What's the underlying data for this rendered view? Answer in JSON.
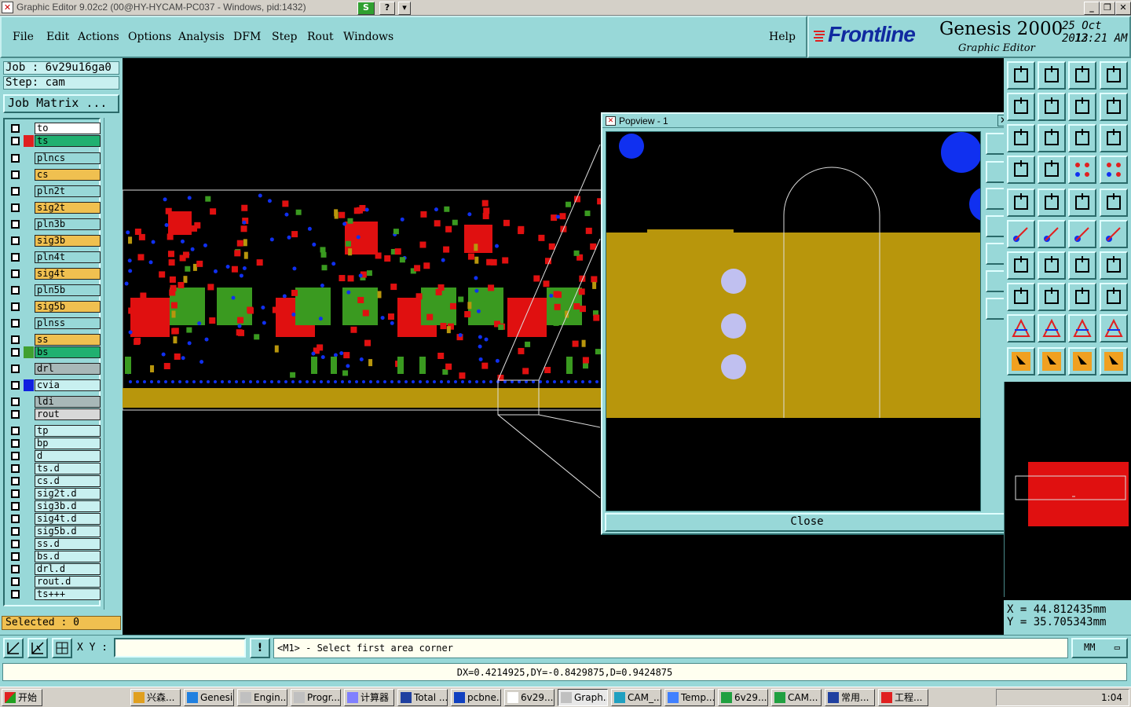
{
  "window": {
    "title": "Graphic Editor 9.02c2 (00@HY-HYCAM-PC037 - Windows, pid:1432)"
  },
  "menu": [
    "File",
    "Edit",
    "Actions",
    "Options",
    "Analysis",
    "DFM",
    "Step",
    "Rout",
    "Windows"
  ],
  "help_label": "Help",
  "brand": {
    "logo": "Frontline",
    "product": "Genesis 2000",
    "subtitle": "Graphic Editor",
    "date": "25 Oct 2013",
    "time": "12:21 AM"
  },
  "job": {
    "job_label": "Job : 6v29u16ga0",
    "step_label": "Step: cam",
    "matrix_label": "Job Matrix ..."
  },
  "layers": [
    {
      "name": "to",
      "color": "#ffffff",
      "swatch": ""
    },
    {
      "name": "ts",
      "color": "#20b070",
      "swatch": "#e02020"
    },
    {
      "name": "plncs",
      "color": "#98d8d8",
      "swatch": ""
    },
    {
      "name": "cs",
      "color": "#f0c050",
      "swatch": ""
    },
    {
      "name": "pln2t",
      "color": "#98d8d8",
      "swatch": ""
    },
    {
      "name": "sig2t",
      "color": "#f0c050",
      "swatch": ""
    },
    {
      "name": "pln3b",
      "color": "#98d8d8",
      "swatch": ""
    },
    {
      "name": "sig3b",
      "color": "#f0c050",
      "swatch": ""
    },
    {
      "name": "pln4t",
      "color": "#98d8d8",
      "swatch": ""
    },
    {
      "name": "sig4t",
      "color": "#f0c050",
      "swatch": ""
    },
    {
      "name": "pln5b",
      "color": "#98d8d8",
      "swatch": ""
    },
    {
      "name": "sig5b",
      "color": "#f0c050",
      "swatch": ""
    },
    {
      "name": "plnss",
      "color": "#98d8d8",
      "swatch": ""
    },
    {
      "name": "ss",
      "color": "#f0c050",
      "swatch": ""
    },
    {
      "name": "bs",
      "color": "#20b070",
      "swatch": "#40a030"
    },
    {
      "name": "drl",
      "color": "#a8b8b8",
      "swatch": ""
    },
    {
      "name": "cvia",
      "color": "#c8f0f0",
      "swatch": "#1020e0"
    },
    {
      "name": "ldi",
      "color": "#a8b8b8",
      "swatch": ""
    },
    {
      "name": "rout",
      "color": "#d8d8d8",
      "swatch": ""
    },
    {
      "name": "tp",
      "color": "#c8f0f0",
      "swatch": ""
    },
    {
      "name": "bp",
      "color": "#c8f0f0",
      "swatch": ""
    },
    {
      "name": "d",
      "color": "#c8f0f0",
      "swatch": ""
    },
    {
      "name": "ts.d",
      "color": "#c8f0f0",
      "swatch": ""
    },
    {
      "name": "cs.d",
      "color": "#c8f0f0",
      "swatch": ""
    },
    {
      "name": "sig2t.d",
      "color": "#c8f0f0",
      "swatch": ""
    },
    {
      "name": "sig3b.d",
      "color": "#c8f0f0",
      "swatch": ""
    },
    {
      "name": "sig4t.d",
      "color": "#c8f0f0",
      "swatch": ""
    },
    {
      "name": "sig5b.d",
      "color": "#c8f0f0",
      "swatch": ""
    },
    {
      "name": "ss.d",
      "color": "#c8f0f0",
      "swatch": ""
    },
    {
      "name": "bs.d",
      "color": "#c8f0f0",
      "swatch": ""
    },
    {
      "name": "drl.d",
      "color": "#c8f0f0",
      "swatch": ""
    },
    {
      "name": "rout.d",
      "color": "#c8f0f0",
      "swatch": ""
    },
    {
      "name": "ts+++",
      "color": "#c8f0f0",
      "swatch": ""
    }
  ],
  "selected_label": "Selected : 0",
  "popview": {
    "title": "Popview - 1",
    "close_label": "Close"
  },
  "coords": {
    "x": "X = 44.812435mm",
    "y": "Y = 35.705343mm"
  },
  "command": {
    "xy_label": "X Y :",
    "xy_value": "",
    "prompt": "<M1> - Select first area corner",
    "units": "MM"
  },
  "status": "DX=0.4214925,DY=-0.8429875,D=0.9424875",
  "taskbar": {
    "start": "开始",
    "tasks": [
      "兴森...",
      "Genesis",
      "Engin...",
      "Progr...",
      "计算器",
      "Total ...",
      "pcbne...",
      "6v29...",
      "Graph...",
      "CAM_...",
      "Temp...",
      "6v29...",
      "CAM...",
      "常用...",
      "工程..."
    ],
    "clock": "1:04"
  }
}
